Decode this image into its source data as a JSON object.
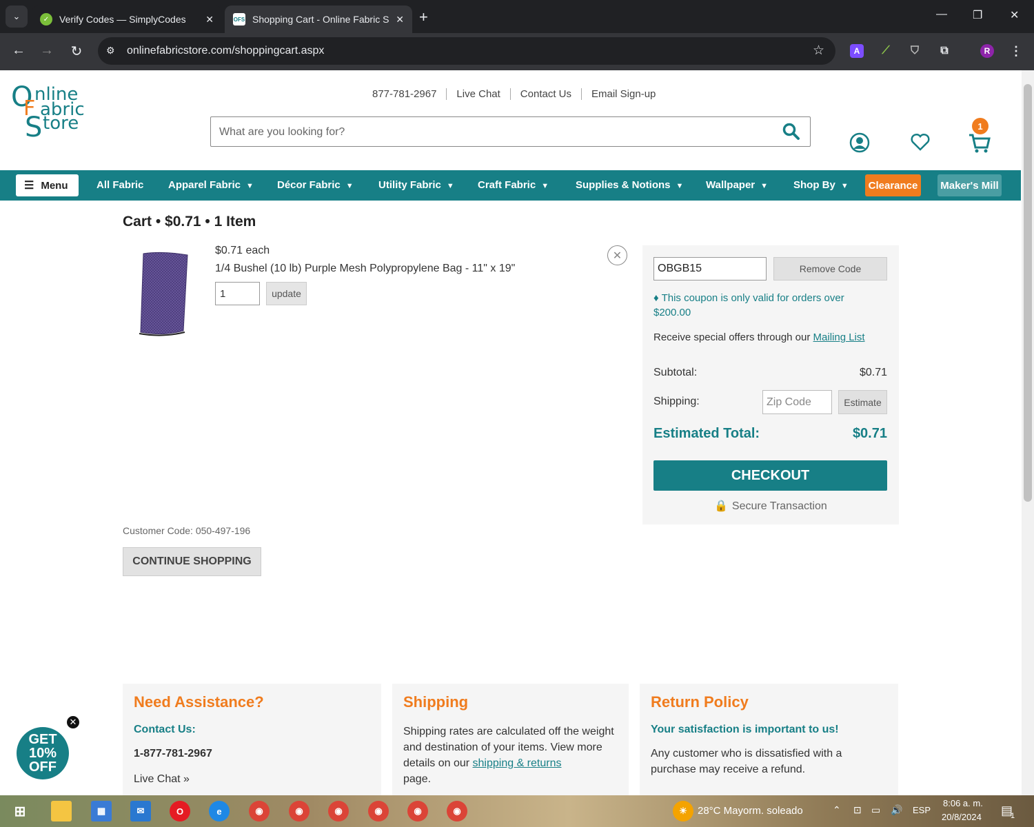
{
  "browser": {
    "tabs": [
      {
        "title": "Verify Codes — SimplyCodes",
        "active": false
      },
      {
        "title": "Shopping Cart - Online Fabric S",
        "active": true
      }
    ],
    "url": "onlinefabricstore.com/shoppingcart.aspx",
    "profile_initial": "R"
  },
  "header": {
    "logo": {
      "l1": "nline",
      "l2": "abric",
      "l3": "tore",
      "o": "O",
      "f": "F",
      "s": "S"
    },
    "links": [
      "877-781-2967",
      "Live Chat",
      "Contact Us",
      "Email Sign-up"
    ],
    "search_placeholder": "What are you looking for?",
    "cart_count": "1"
  },
  "nav": {
    "menu_label": "Menu",
    "items": [
      "All Fabric",
      "Apparel Fabric",
      "Décor Fabric",
      "Utility Fabric",
      "Craft Fabric",
      "Supplies & Notions",
      "Wallpaper",
      "Shop By"
    ],
    "clearance": "Clearance",
    "makers_mill": "Maker's Mill"
  },
  "cart": {
    "title": "Cart • $0.71 • 1 Item",
    "item": {
      "price_each": "$0.71 each",
      "name": "1/4 Bushel (10 lb) Purple Mesh Polypropylene Bag - 11\" x 19\"",
      "quantity": "1",
      "update_label": "update"
    },
    "customer_code": "Customer Code: 050-497-196",
    "continue_label": "CONTINUE SHOPPING"
  },
  "summary": {
    "coupon_value": "OBGB15",
    "remove_code_label": "Remove Code",
    "coupon_note": "This coupon is only valid for orders over $200.00",
    "offers_text": "Receive special offers through our",
    "offers_link": "Mailing List",
    "subtotal_label": "Subtotal:",
    "subtotal_value": "$0.71",
    "shipping_label": "Shipping:",
    "zip_placeholder": "Zip Code",
    "estimate_label": "Estimate",
    "total_label": "Estimated Total:",
    "total_value": "$0.71",
    "checkout_label": "CHECKOUT",
    "secure_label": "Secure Transaction"
  },
  "footer": {
    "assist": {
      "title": "Need Assistance?",
      "subtitle": "Contact Us:",
      "phone": "1-877-781-2967",
      "chat": "Live Chat »"
    },
    "shipping": {
      "title": "Shipping",
      "text": "Shipping rates are calculated off the weight and destination of your items. View more details on our",
      "link": "shipping & returns",
      "after": "page."
    },
    "returns": {
      "title": "Return Policy",
      "subtitle": "Your satisfaction is important to us!",
      "text": "Any customer who is dissatisfied with a purchase may receive a refund."
    }
  },
  "promo": {
    "l1": "GET",
    "l2": "10%",
    "l3": "OFF"
  },
  "taskbar": {
    "weather": "28°C  Mayorm. soleado",
    "lang": "ESP",
    "time": "8:06 a. m.",
    "date": "20/8/2024",
    "notif_count": "1"
  },
  "colors": {
    "teal": "#177f86",
    "orange": "#f07c1e"
  }
}
